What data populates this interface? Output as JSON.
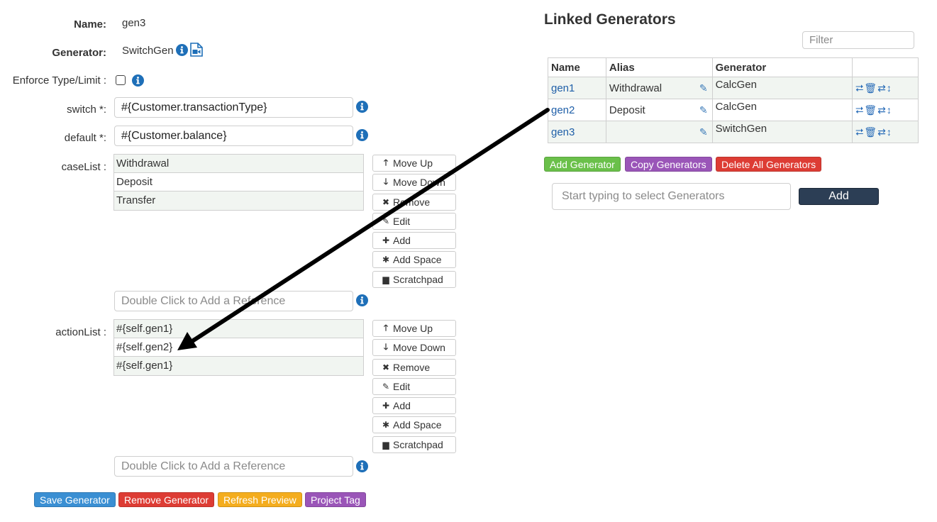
{
  "form": {
    "name_label": "Name:",
    "name_value": "gen3",
    "generator_label": "Generator:",
    "generator_value": "SwitchGen",
    "enforce_label": "Enforce Type/Limit :",
    "switch_label": "switch *:",
    "switch_value": "#{Customer.transactionType}",
    "default_label": "default *:",
    "default_value": "#{Customer.balance}",
    "caselist_label": "caseList :",
    "caselist_items": [
      "Withdrawal",
      "Deposit",
      "Transfer"
    ],
    "reference_placeholder": "Double Click to Add a Reference",
    "actionlist_label": "actionList :",
    "actionlist_items": [
      "#{self.gen1}",
      "#{self.gen2}",
      "#{self.gen1}"
    ]
  },
  "list_buttons": {
    "move_up": "Move Up",
    "move_down": "Move Down",
    "remove": "Remove",
    "edit": "Edit",
    "add": "Add",
    "add_space": "Add Space",
    "scratchpad": "Scratchpad"
  },
  "bottom_buttons": {
    "save": "Save Generator",
    "remove": "Remove Generator",
    "refresh": "Refresh Preview",
    "project_tag": "Project Tag"
  },
  "linked": {
    "title": "Linked Generators",
    "filter_placeholder": "Filter",
    "columns": [
      "Name",
      "Alias",
      "Generator"
    ],
    "rows": [
      {
        "name": "gen1",
        "alias": "Withdrawal",
        "generator": "CalcGen"
      },
      {
        "name": "gen2",
        "alias": "Deposit",
        "generator": "CalcGen"
      },
      {
        "name": "gen3",
        "alias": "",
        "generator": "SwitchGen"
      }
    ],
    "add_generator": "Add Generator",
    "copy_generators": "Copy Generators",
    "delete_all": "Delete All Generators",
    "select_placeholder": "Start typing to select Generators",
    "add_label": "Add"
  },
  "colors": {
    "info_blue": "#1e6fb8",
    "save_blue": "#3a8fd3",
    "remove_red": "#dd3c34",
    "refresh_orange": "#f4ad1e",
    "tag_purple": "#9a55b8",
    "add_green": "#6ac04a",
    "link_blue": "#1f5fa8",
    "add_dark": "#2c3e55"
  },
  "icons": [
    "info-icon",
    "video-doc-icon",
    "arrow-up-icon",
    "arrow-down-icon",
    "remove-x-icon",
    "pencil-icon",
    "plus-icon",
    "asterisk-icon",
    "file-icon",
    "clone-icon",
    "trash-icon",
    "swap-icon",
    "vertical-arrows-icon"
  ]
}
